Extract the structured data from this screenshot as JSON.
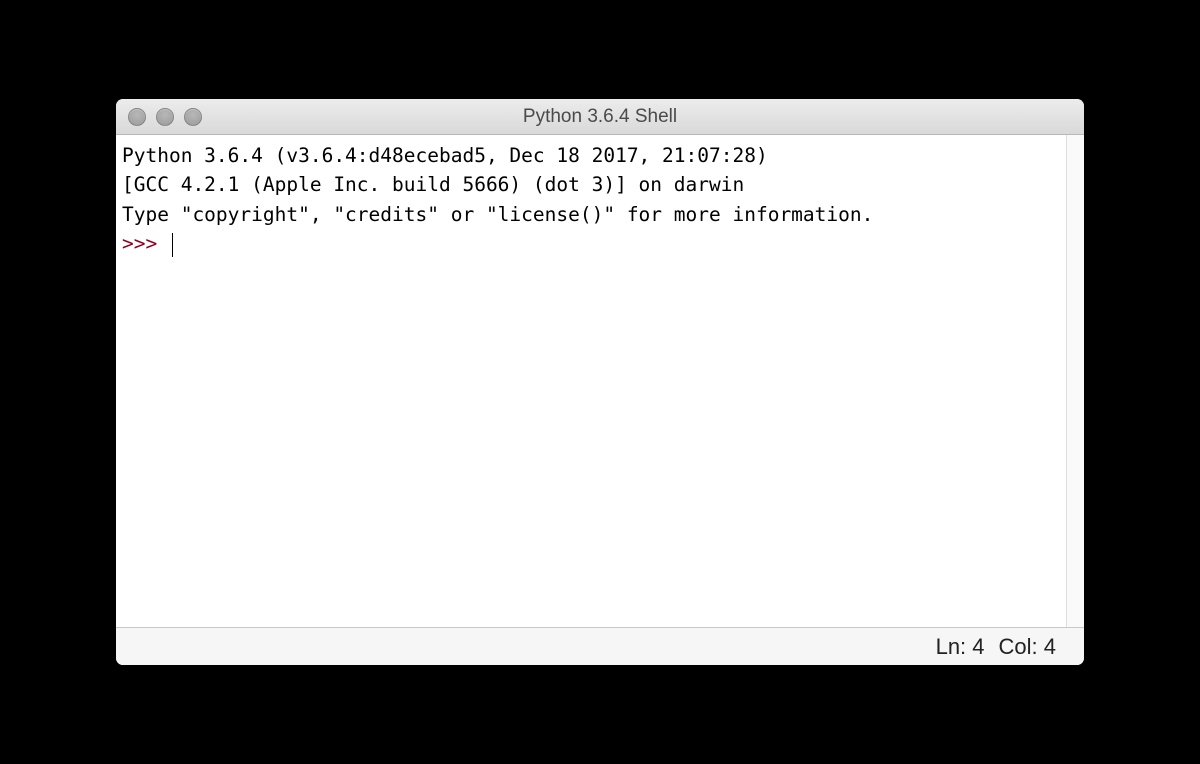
{
  "window": {
    "title": "Python 3.6.4 Shell"
  },
  "shell": {
    "line1": "Python 3.6.4 (v3.6.4:d48ecebad5, Dec 18 2017, 21:07:28) ",
    "line2": "[GCC 4.2.1 (Apple Inc. build 5666) (dot 3)] on darwin",
    "line3": "Type \"copyright\", \"credits\" or \"license()\" for more information.",
    "prompt": ">>> "
  },
  "status": {
    "line_label": "Ln: 4",
    "col_label": "Col: 4"
  }
}
